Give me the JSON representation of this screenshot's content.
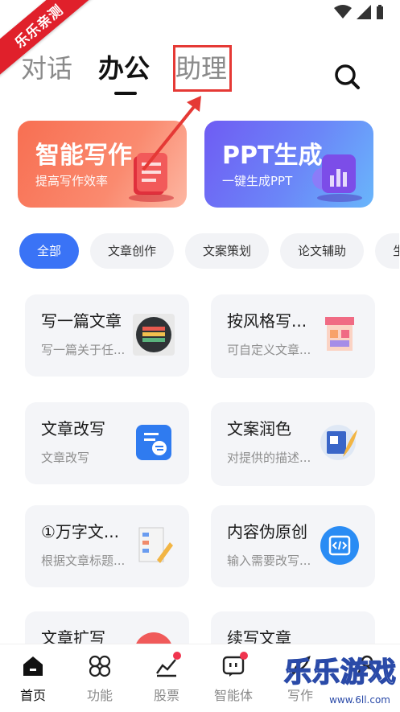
{
  "status": {
    "icons": [
      "wifi-icon",
      "signal-icon",
      "battery-icon"
    ]
  },
  "watermark": {
    "ribbon": "乐乐亲测",
    "corner": "乐乐游戏",
    "url": "www.6ll.com"
  },
  "top_tabs": [
    {
      "label": "对话",
      "active": false
    },
    {
      "label": "办公",
      "active": true
    },
    {
      "label": "助理",
      "active": false
    }
  ],
  "banners": {
    "write": {
      "title": "智能写作",
      "subtitle": "提高写作效率",
      "color": "#f86f52"
    },
    "ppt": {
      "title": "PPT生成",
      "subtitle": "一键生成PPT",
      "color": "#6f5cf3"
    }
  },
  "chips": [
    "全部",
    "文章创作",
    "文案策划",
    "论文辅助",
    "生"
  ],
  "cards": [
    {
      "title": "写一篇文章",
      "desc": "写一篇关于任...",
      "icon": "books-icon"
    },
    {
      "title": "按风格写...",
      "desc": "可自定义文章...",
      "icon": "news-stand-icon"
    },
    {
      "title": "文章改写",
      "desc": "文章改写",
      "icon": "document-swap-icon"
    },
    {
      "title": "文案润色",
      "desc": "对提供的描述...",
      "icon": "doc-feather-icon"
    },
    {
      "title": "①万字文...",
      "desc": "根据文章标题...",
      "icon": "outline-pencil-icon"
    },
    {
      "title": "内容伪原创",
      "desc": "输入需要改写...",
      "icon": "code-icon"
    },
    {
      "title": "文章扩写",
      "desc": "",
      "icon": "red-circle-icon"
    },
    {
      "title": "续写文章",
      "desc": "",
      "icon": "green-doc-icon"
    }
  ],
  "nav": [
    {
      "label": "首页",
      "icon": "home-icon",
      "active": true,
      "dot": false
    },
    {
      "label": "功能",
      "icon": "grid-icon",
      "active": false,
      "dot": false
    },
    {
      "label": "股票",
      "icon": "chart-icon",
      "active": false,
      "dot": true
    },
    {
      "label": "智能体",
      "icon": "agent-icon",
      "active": false,
      "dot": true
    },
    {
      "label": "写作",
      "icon": "quill-icon",
      "active": false,
      "dot": false
    },
    {
      "label": "",
      "icon": "profile-icon",
      "active": false,
      "dot": false
    }
  ],
  "colors": {
    "accent": "#3a73f6",
    "badge": "#f0344e",
    "annotation": "#e53935"
  }
}
